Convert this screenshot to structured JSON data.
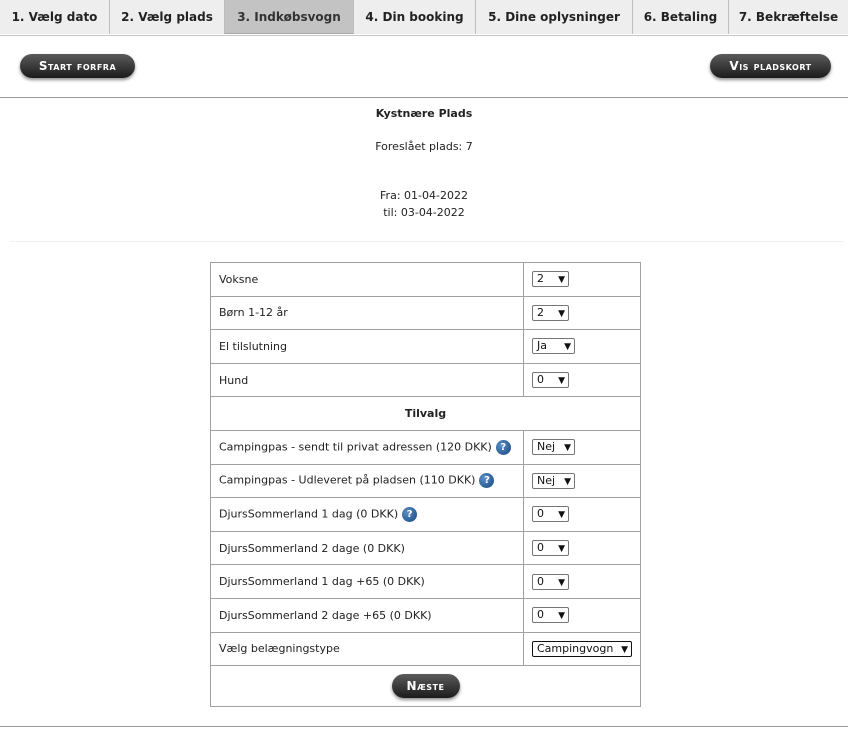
{
  "tabs": [
    {
      "label": "1. Vælg dato"
    },
    {
      "label": "2. Vælg plads"
    },
    {
      "label": "3. Indkøbsvogn"
    },
    {
      "label": "4. Din booking"
    },
    {
      "label": "5. Dine oplysninger"
    },
    {
      "label": "6. Betaling"
    },
    {
      "label": "7. Bekræftelse"
    }
  ],
  "active_tab_index": 2,
  "buttons": {
    "start_over": "Start forfra",
    "show_map": "Vis pladskort",
    "next": "Næste"
  },
  "booking": {
    "area": "Kystnære Plads",
    "suggested": "Foreslået plads: 7",
    "from": "Fra: 01-04-2022",
    "to": "til: 03-04-2022"
  },
  "form": {
    "rows": [
      {
        "label": "Voksne",
        "value": "2"
      },
      {
        "label": "Børn 1-12 år",
        "value": "2"
      },
      {
        "label": "El tilslutning",
        "value": "Ja"
      },
      {
        "label": "Hund",
        "value": "0"
      }
    ],
    "addons_heading": "Tilvalg",
    "addons": [
      {
        "label": "Campingpas - sendt til privat adressen (120 DKK)",
        "value": "Nej",
        "help": true
      },
      {
        "label": "Campingpas - Udleveret på pladsen (110 DKK)",
        "value": "Nej",
        "help": true
      },
      {
        "label": "DjursSommerland 1 dag (0 DKK)",
        "value": "0",
        "help": true
      },
      {
        "label": "DjursSommerland 2 dage (0 DKK)",
        "value": "0",
        "help": false
      },
      {
        "label": "DjursSommerland 1 dag +65 (0 DKK)",
        "value": "0",
        "help": false
      },
      {
        "label": "DjursSommerland 2 dage +65 (0 DKK)",
        "value": "0",
        "help": false
      }
    ],
    "type_label": "Vælg belægningstype",
    "type_value": "Campingvogn"
  },
  "icons": {
    "help": "question-mark-icon",
    "dropdown": "chevron-down-icon"
  }
}
